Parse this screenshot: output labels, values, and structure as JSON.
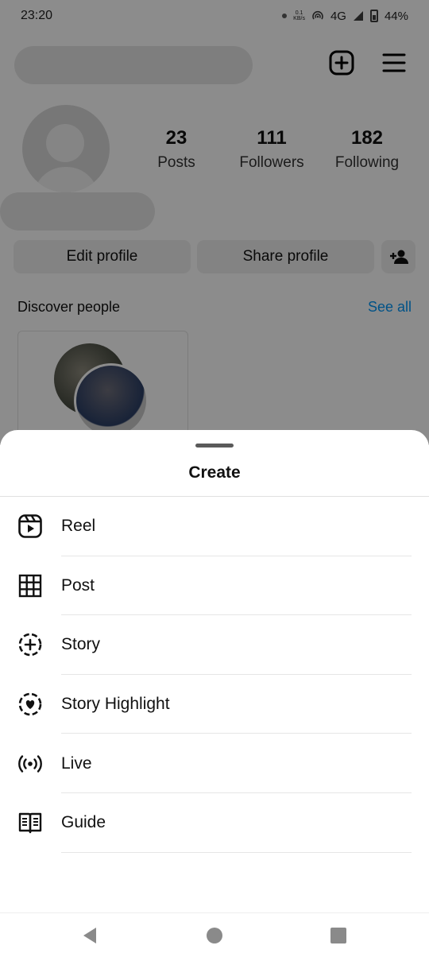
{
  "status_bar": {
    "time": "23:20",
    "speed_top": "0.1",
    "speed_unit": "KB/s",
    "network": "4G",
    "battery": "44%"
  },
  "profile": {
    "stats": [
      {
        "value": "23",
        "label": "Posts"
      },
      {
        "value": "111",
        "label": "Followers"
      },
      {
        "value": "182",
        "label": "Following"
      }
    ],
    "edit_button": "Edit profile",
    "share_button": "Share profile",
    "discover_label": "Discover people",
    "see_all": "See all"
  },
  "sheet": {
    "title": "Create",
    "items": [
      {
        "label": "Reel",
        "icon": "reel-icon"
      },
      {
        "label": "Post",
        "icon": "grid-icon"
      },
      {
        "label": "Story",
        "icon": "story-add-icon"
      },
      {
        "label": "Story Highlight",
        "icon": "highlight-heart-icon"
      },
      {
        "label": "Live",
        "icon": "live-broadcast-icon"
      },
      {
        "label": "Guide",
        "icon": "guide-book-icon"
      }
    ]
  },
  "colors": {
    "link": "#0095f6",
    "overlay": "rgba(0,0,0,0.45)"
  }
}
